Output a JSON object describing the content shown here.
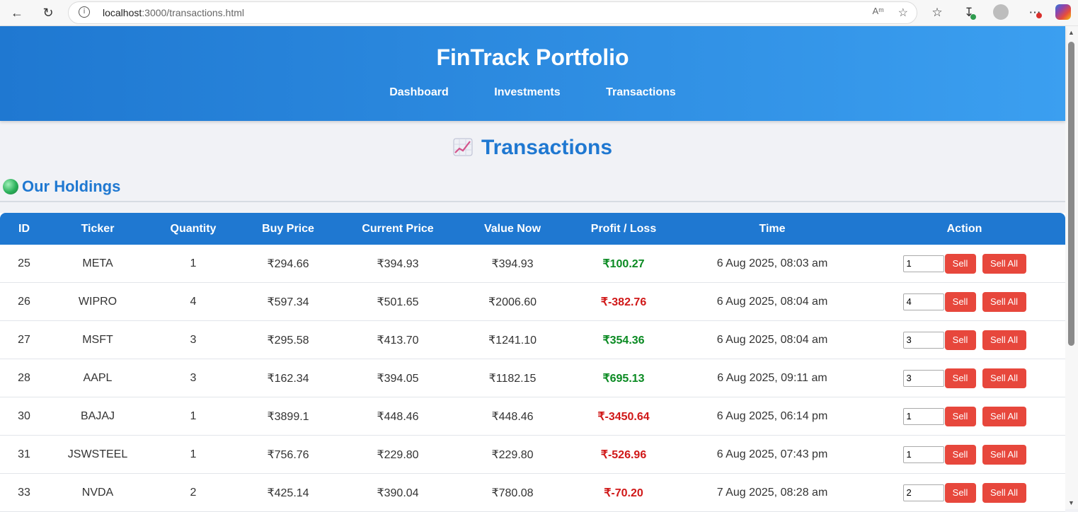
{
  "browser": {
    "url_host": "localhost",
    "url_rest": ":3000/transactions.html"
  },
  "header": {
    "brand": "FinTrack Portfolio",
    "nav": [
      "Dashboard",
      "Investments",
      "Transactions"
    ]
  },
  "page": {
    "title": "Transactions",
    "title_icon": "chart-increasing-icon",
    "section_title": "Our Holdings",
    "section_icon": "globe-icon"
  },
  "table": {
    "columns": [
      "ID",
      "Ticker",
      "Quantity",
      "Buy Price",
      "Current Price",
      "Value Now",
      "Profit / Loss",
      "Time",
      "Action"
    ],
    "rows": [
      {
        "id": "25",
        "ticker": "META",
        "quantity": "1",
        "buy": "₹294.66",
        "current": "₹394.93",
        "value": "₹394.93",
        "pl": "₹100.27",
        "pl_sign": "pos",
        "time": "6 Aug 2025, 08:03 am",
        "qty_input": "1"
      },
      {
        "id": "26",
        "ticker": "WIPRO",
        "quantity": "4",
        "buy": "₹597.34",
        "current": "₹501.65",
        "value": "₹2006.60",
        "pl": "₹-382.76",
        "pl_sign": "neg",
        "time": "6 Aug 2025, 08:04 am",
        "qty_input": "4"
      },
      {
        "id": "27",
        "ticker": "MSFT",
        "quantity": "3",
        "buy": "₹295.58",
        "current": "₹413.70",
        "value": "₹1241.10",
        "pl": "₹354.36",
        "pl_sign": "pos",
        "time": "6 Aug 2025, 08:04 am",
        "qty_input": "3"
      },
      {
        "id": "28",
        "ticker": "AAPL",
        "quantity": "3",
        "buy": "₹162.34",
        "current": "₹394.05",
        "value": "₹1182.15",
        "pl": "₹695.13",
        "pl_sign": "pos",
        "time": "6 Aug 2025, 09:11 am",
        "qty_input": "3"
      },
      {
        "id": "30",
        "ticker": "BAJAJ",
        "quantity": "1",
        "buy": "₹3899.1",
        "current": "₹448.46",
        "value": "₹448.46",
        "pl": "₹-3450.64",
        "pl_sign": "neg",
        "time": "6 Aug 2025, 06:14 pm",
        "qty_input": "1"
      },
      {
        "id": "31",
        "ticker": "JSWSTEEL",
        "quantity": "1",
        "buy": "₹756.76",
        "current": "₹229.80",
        "value": "₹229.80",
        "pl": "₹-526.96",
        "pl_sign": "neg",
        "time": "6 Aug 2025, 07:43 pm",
        "qty_input": "1"
      },
      {
        "id": "33",
        "ticker": "NVDA",
        "quantity": "2",
        "buy": "₹425.14",
        "current": "₹390.04",
        "value": "₹780.08",
        "pl": "₹-70.20",
        "pl_sign": "neg",
        "time": "7 Aug 2025, 08:28 am",
        "qty_input": "2"
      }
    ],
    "sell_label": "Sell",
    "sell_all_label": "Sell All"
  },
  "colors": {
    "primary": "#1f78d1",
    "profit": "#0a8a22",
    "loss": "#d01818",
    "sell_button": "#e7473c"
  }
}
